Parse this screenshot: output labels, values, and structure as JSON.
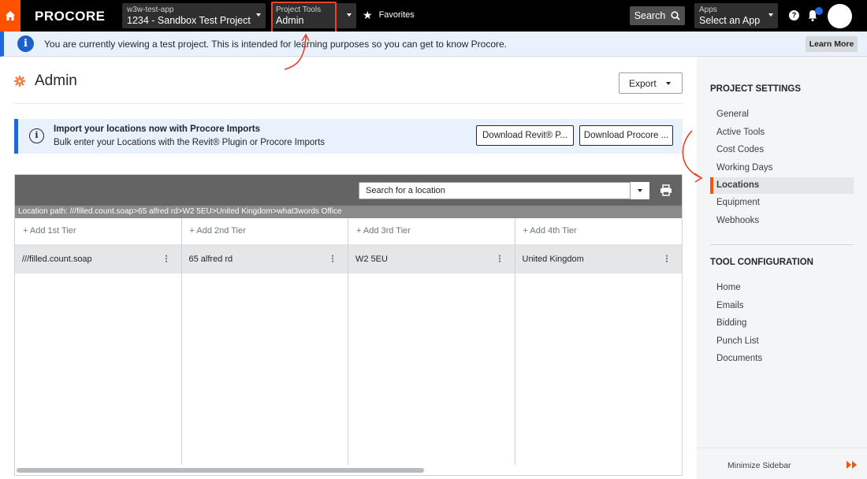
{
  "nav": {
    "logo": "PROCORE",
    "company": "w3w-test-app",
    "project": "1234 - Sandbox Test Project",
    "tools_label": "Project Tools",
    "tools_value": "Admin",
    "favorites": "Favorites",
    "search": "Search",
    "apps_label": "Apps",
    "apps_value": "Select an App",
    "help": "?"
  },
  "banner": {
    "message": "You are currently viewing a test project. This is intended for learning purposes so you can get to know Procore.",
    "learn_more": "Learn More"
  },
  "page": {
    "title": "Admin",
    "export": "Export"
  },
  "import": {
    "title": "Import your locations now with Procore Imports",
    "subtitle": "Bulk enter your Locations with the Revit® Plugin or Procore Imports",
    "revit_button": "Download Revit® P...",
    "procore_button": "Download Procore ..."
  },
  "locations": {
    "search_placeholder": "Search for a location",
    "path": "Location path: ///filled.count.soap>65 alfred rd>W2 5EU>United Kingdom>what3words Office",
    "tiers": [
      {
        "add": "+ Add 1st Tier",
        "item": "///filled.count.soap"
      },
      {
        "add": "+ Add 2nd Tier",
        "item": "65 alfred rd"
      },
      {
        "add": "+ Add 3rd Tier",
        "item": "W2 5EU"
      },
      {
        "add": "+ Add 4th Tier",
        "item": "United Kingdom"
      }
    ]
  },
  "sidebar": {
    "project_settings_heading": "PROJECT SETTINGS",
    "project_settings": [
      "General",
      "Active Tools",
      "Cost Codes",
      "Working Days",
      "Locations",
      "Equipment",
      "Webhooks"
    ],
    "active_item": "Locations",
    "tool_config_heading": "TOOL CONFIGURATION",
    "tool_config": [
      "Home",
      "Emails",
      "Bidding",
      "Punch List",
      "Documents"
    ],
    "minimize": "Minimize Sidebar"
  },
  "colors": {
    "brand_orange": "#ff5200",
    "info_blue": "#2066df",
    "annotation_red": "#e8422c"
  }
}
